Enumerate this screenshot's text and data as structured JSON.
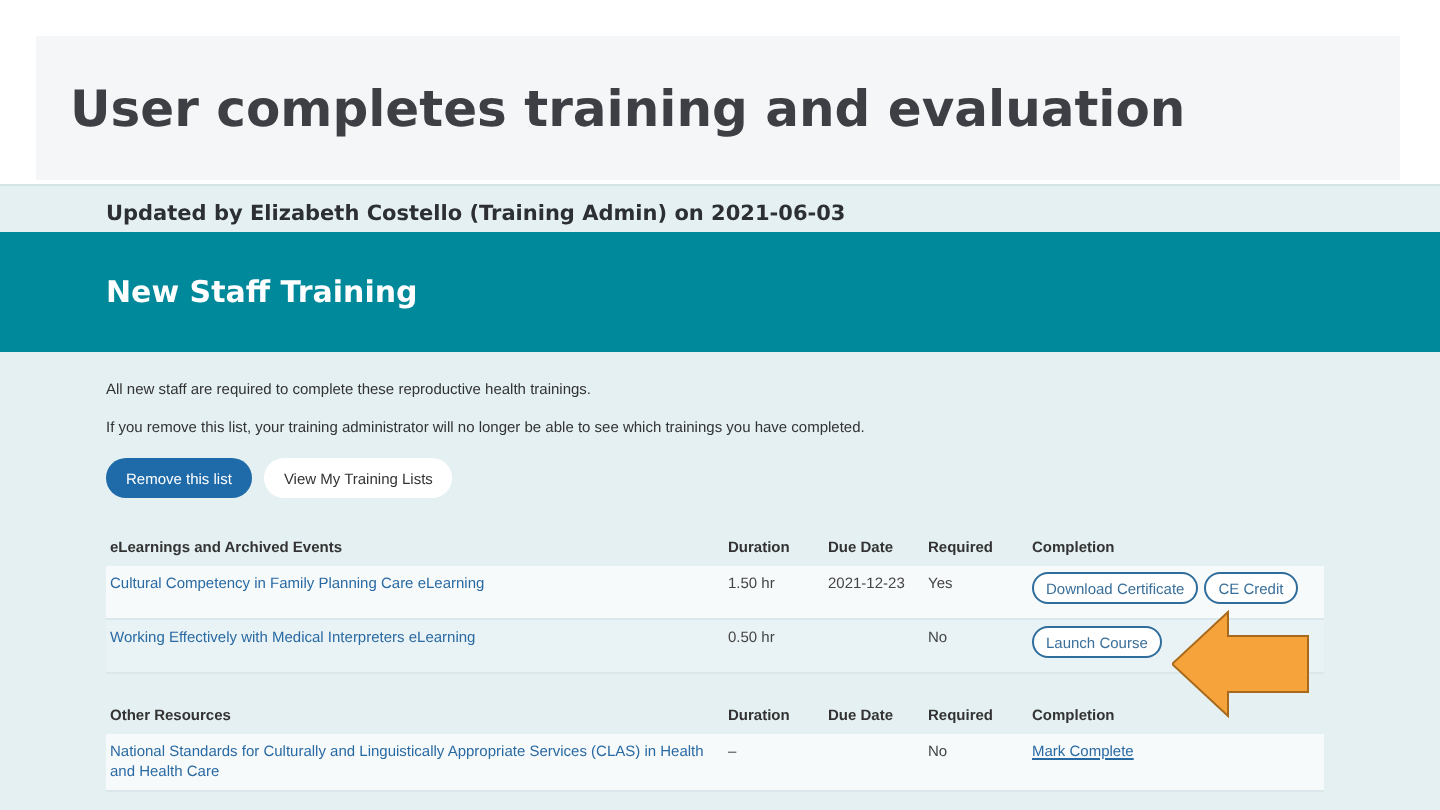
{
  "slide": {
    "title": "User completes training and evaluation"
  },
  "screenshot": {
    "updated_note": "Updated by Elizabeth Costello (Training Admin) on 2021-06-03",
    "banner_title": "New Staff Training",
    "intro": [
      "All new staff are required to complete these reproductive health trainings.",
      "If you remove this list, your training administrator will no longer be able to see which trainings you have completed."
    ],
    "buttons": [
      {
        "label": "Remove this list",
        "kind": "primary"
      },
      {
        "label": "View My Training Lists",
        "kind": "secondary"
      }
    ],
    "sections": [
      {
        "columns": [
          "eLearnings and Archived Events",
          "Duration",
          "Due Date",
          "Required",
          "Completion"
        ],
        "rows": [
          {
            "title": "Cultural Competency in Family Planning Care eLearning",
            "duration": "1.50 hr",
            "due_date": "2021-12-23",
            "required": "Yes",
            "actions": [
              {
                "label": "Download Certificate",
                "kind": "button"
              },
              {
                "label": "CE Credit",
                "kind": "button"
              }
            ]
          },
          {
            "title": "Working Effectively with Medical Interpreters eLearning",
            "duration": "0.50 hr",
            "required": "No",
            "actions": [
              {
                "label": "Launch Course",
                "kind": "button"
              }
            ]
          }
        ]
      },
      {
        "columns": [
          "Other Resources",
          "Duration",
          "Due Date",
          "Required",
          "Completion"
        ],
        "rows": [
          {
            "title": "National Standards for Culturally and Linguistically Appropriate Services (CLAS) in Health and Health Care",
            "duration": "–",
            "required": "No",
            "actions": [
              {
                "label": "Mark Complete",
                "kind": "link"
              }
            ]
          }
        ]
      }
    ]
  }
}
